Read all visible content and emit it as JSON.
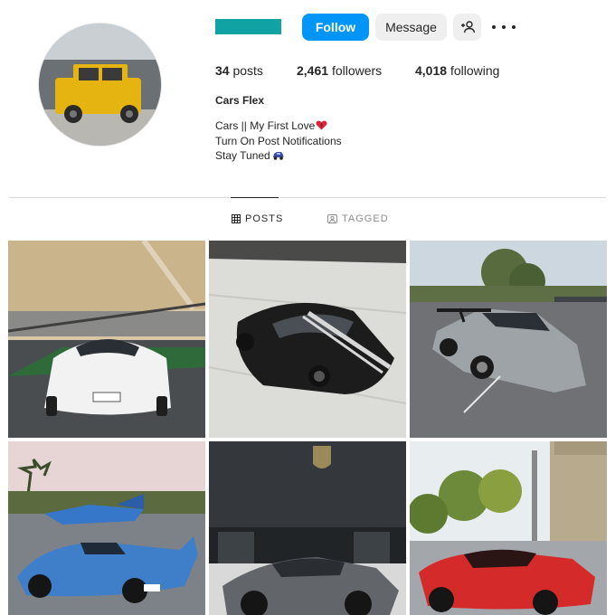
{
  "profile": {
    "username_color": "#11a3a3",
    "avatar_alt": "profile-photo-yellow-suv",
    "display_name": "Cars Flex",
    "bio_lines": [
      "Cars || My First Love",
      "Turn On Post Notifications",
      "Stay Tuned"
    ]
  },
  "actions": {
    "follow_label": "Follow",
    "message_label": "Message",
    "add_user_icon": "person-plus-icon",
    "more_icon": "more-horizontal-icon"
  },
  "stats": {
    "posts_count": "34",
    "posts_label": "posts",
    "followers_count": "2,461",
    "followers_label": "followers",
    "following_count": "4,018",
    "following_label": "following"
  },
  "tabs": [
    {
      "label": "POSTS",
      "icon": "grid-icon",
      "active": true
    },
    {
      "label": "TAGGED",
      "icon": "tag-icon",
      "active": false
    }
  ],
  "colors": {
    "accent": "#0095f6",
    "text": "#262626",
    "muted": "#8e8e8e",
    "divider": "#dbdbdb"
  }
}
